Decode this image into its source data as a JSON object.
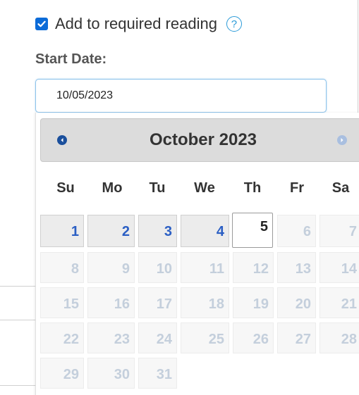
{
  "form": {
    "required_reading_label": "Add to required reading",
    "required_reading_checked": true,
    "help_glyph": "?",
    "start_date_label": "Start Date:",
    "start_date_value": "10/05/2023"
  },
  "datepicker": {
    "month_title": "October 2023",
    "prev_icon": "chevron-left-icon",
    "next_icon": "chevron-right-icon",
    "weekdays": [
      "Su",
      "Mo",
      "Tu",
      "We",
      "Th",
      "Fr",
      "Sa"
    ],
    "weeks": [
      [
        "1",
        "2",
        "3",
        "4",
        "5",
        "6",
        "7"
      ],
      [
        "8",
        "9",
        "10",
        "11",
        "12",
        "13",
        "14"
      ],
      [
        "15",
        "16",
        "17",
        "18",
        "19",
        "20",
        "21"
      ],
      [
        "22",
        "23",
        "24",
        "25",
        "26",
        "27",
        "28"
      ],
      [
        "29",
        "30",
        "31"
      ]
    ],
    "today": "5",
    "colors": {
      "selectable_day": "#2b5fc4",
      "disabled_day": "#c4cfdc",
      "checkbox": "#0b6bd8",
      "help_icon": "#2b9bd8"
    }
  }
}
